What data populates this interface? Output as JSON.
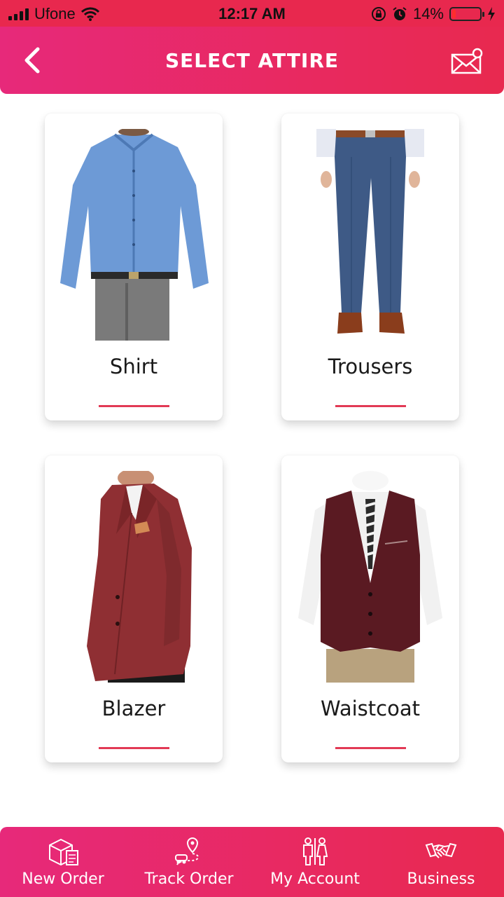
{
  "status_bar": {
    "carrier": "Ufone",
    "time": "12:17 AM",
    "battery_percent": "14%",
    "battery_level": 0.14,
    "icons": [
      "signal-icon",
      "wifi-icon",
      "orientation-lock-icon",
      "alarm-icon",
      "battery-icon",
      "charging-icon"
    ]
  },
  "header": {
    "title": "SELECT ATTIRE",
    "back_icon": "chevron-left-icon",
    "mail_icon": "mail-notification-icon"
  },
  "attire": [
    {
      "label": "Shirt",
      "image": "shirt-image"
    },
    {
      "label": "Trousers",
      "image": "trousers-image"
    },
    {
      "label": "Blazer",
      "image": "blazer-image"
    },
    {
      "label": "Waistcoat",
      "image": "waistcoat-image"
    }
  ],
  "bottom_nav": [
    {
      "label": "New Order",
      "icon": "order-box-icon"
    },
    {
      "label": "Track Order",
      "icon": "track-location-icon"
    },
    {
      "label": "My Account",
      "icon": "people-icon"
    },
    {
      "label": "Business",
      "icon": "handshake-icon"
    }
  ],
  "colors": {
    "accent_start": "#e7297a",
    "accent_end": "#e8294f",
    "underline": "#e23a55"
  }
}
